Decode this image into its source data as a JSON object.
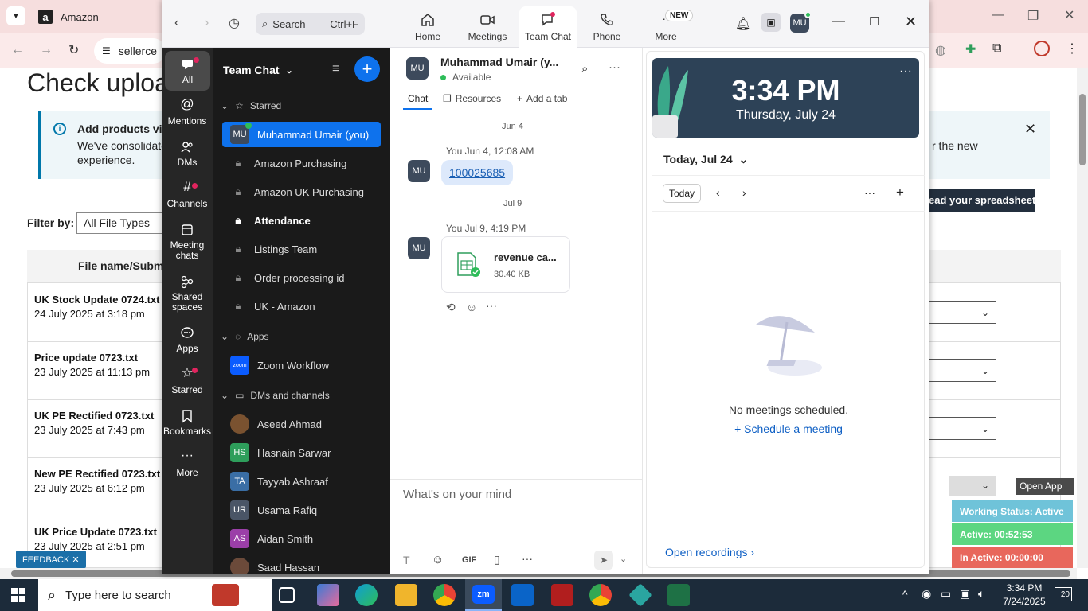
{
  "browser": {
    "tab_title": "Amazon",
    "url_fragment": "sellerce"
  },
  "page": {
    "title": "Check uploa",
    "info_title": "Add products via",
    "info_text_1": "We've consolidated",
    "info_text_2": "experience.",
    "info_text_right": "r the new",
    "upload_button": "ead your spreadsheet",
    "filter_label": "Filter by:",
    "filter_value": "All File Types",
    "table_header": "File name/Submit",
    "files": [
      {
        "name": "UK Stock Update 0724.txt",
        "date": "24 July 2025 at 3:18 pm"
      },
      {
        "name": "Price update 0723.txt",
        "date": "23 July 2025 at 11:13 pm"
      },
      {
        "name": "UK PE Rectified 0723.txt",
        "date": "23 July 2025 at 7:43 pm"
      },
      {
        "name": "New PE Rectified 0723.txt",
        "date": "23 July 2025 at 6:12 pm"
      },
      {
        "name": "UK Price Update 0723.txt",
        "date": "23 July 2025 at 2:51 pm"
      }
    ],
    "feedback": "FEEDBACK"
  },
  "zoom": {
    "search_placeholder": "Search",
    "search_shortcut": "Ctrl+F",
    "nav": [
      {
        "label": "Home"
      },
      {
        "label": "Meetings"
      },
      {
        "label": "Team Chat"
      },
      {
        "label": "Phone"
      },
      {
        "label": "More",
        "badge": "NEW"
      }
    ],
    "user_initials": "MU",
    "rail": [
      {
        "label": "All"
      },
      {
        "label": "Mentions"
      },
      {
        "label": "DMs"
      },
      {
        "label": "Channels"
      },
      {
        "label": "Meeting chats"
      },
      {
        "label": "Shared spaces"
      },
      {
        "label": "Apps"
      },
      {
        "label": "Starred"
      },
      {
        "label": "Bookmarks"
      },
      {
        "label": "More"
      }
    ],
    "sidebar": {
      "title": "Team Chat",
      "starred_label": "Starred",
      "starred": [
        {
          "label": "Muhammad Umair (you)",
          "initials": "MU"
        },
        {
          "label": "Amazon Purchasing"
        },
        {
          "label": "Amazon UK Purchasing"
        },
        {
          "label": "Attendance"
        },
        {
          "label": "Listings Team"
        },
        {
          "label": "Order processing id"
        },
        {
          "label": "UK - Amazon"
        }
      ],
      "apps_label": "Apps",
      "apps": [
        {
          "label": "Zoom Workflow",
          "logo": "zoom"
        }
      ],
      "dms_label": "DMs and channels",
      "dms": [
        {
          "label": "Aseed Ahmad",
          "initials": "",
          "color": "#7a5230"
        },
        {
          "label": "Hasnain Sarwar",
          "initials": "HS",
          "color": "#2e9e5b"
        },
        {
          "label": "Tayyab Ashraaf",
          "initials": "TA",
          "color": "#3a6ea5"
        },
        {
          "label": "Usama Rafiq",
          "initials": "UR",
          "color": "#4a5566"
        },
        {
          "label": "Aidan Smith",
          "initials": "AS",
          "color": "#9b3fa8"
        },
        {
          "label": "Saad Hassan",
          "initials": "",
          "color": "#6b4a3a"
        }
      ]
    },
    "chat": {
      "contact_name": "Muhammad Umair (y...",
      "contact_initials": "MU",
      "status": "Available",
      "tabs": [
        {
          "label": "Chat"
        },
        {
          "label": "Resources"
        },
        {
          "label": "Add a tab"
        }
      ],
      "date1": "Jun 4",
      "msg1_meta": "You Jun 4, 12:08 AM",
      "msg1_text": "100025685",
      "date2": "Jul 9",
      "msg2_meta": "You Jul 9, 4:19 PM",
      "file_name": "revenue ca...",
      "file_size": "30.40 KB",
      "composer_placeholder": "What's on your mind",
      "gif_label": "GIF"
    },
    "calendar": {
      "time": "3:34 PM",
      "date": "Thursday, July 24",
      "day_selector": "Today, Jul 24",
      "today_btn": "Today",
      "empty_text": "No meetings scheduled.",
      "schedule_link": "Schedule a meeting",
      "recordings_link": "Open recordings"
    }
  },
  "widgets": {
    "open_app": "Open App",
    "working_status": "Working Status: Active",
    "active": "Active: 00:52:53",
    "inactive": "In Active: 00:00:00"
  },
  "taskbar": {
    "search_placeholder": "Type here to search",
    "time": "3:34 PM",
    "date": "7/24/2025",
    "notification_count": "20"
  }
}
